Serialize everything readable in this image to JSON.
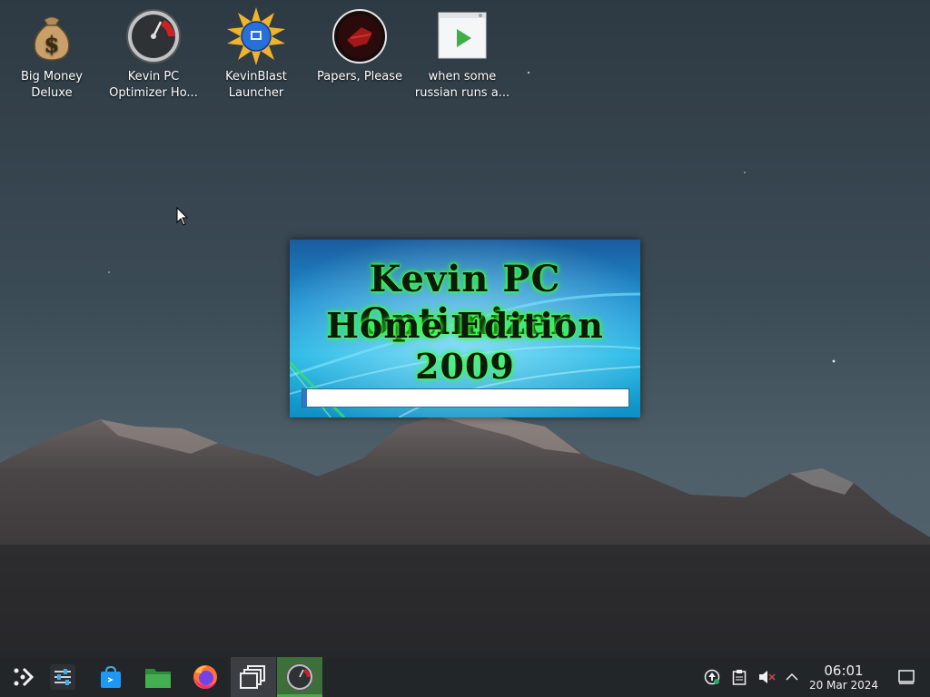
{
  "desktop": {
    "icons": [
      {
        "label": "Big Money Deluxe",
        "icon": "money-bag-icon"
      },
      {
        "label": "Kevin PC Optimizer Ho...",
        "icon": "speedometer-icon"
      },
      {
        "label": "KevinBlast Launcher",
        "icon": "globe-burst-icon"
      },
      {
        "label": "Papers, Please",
        "icon": "papers-please-icon"
      },
      {
        "label": "when some russian runs a...",
        "icon": "video-file-icon"
      }
    ]
  },
  "splash": {
    "title_line1": "Kevin PC Optimizer",
    "title_line2": "Home Edition 2009",
    "progress": 0.015
  },
  "taskbar": {
    "apps": [
      {
        "name": "application-launcher",
        "icon": "launcher-icon"
      },
      {
        "name": "system-settings",
        "icon": "settings-sliders-icon"
      },
      {
        "name": "discover",
        "icon": "store-bag-icon"
      },
      {
        "name": "file-manager",
        "icon": "folder-icon"
      },
      {
        "name": "firefox",
        "icon": "firefox-icon"
      },
      {
        "name": "window-switcher",
        "icon": "windows-icon"
      },
      {
        "name": "kevin-pc-optimizer",
        "icon": "speedometer-icon"
      }
    ],
    "tray": [
      "update-icon",
      "clipboard-icon",
      "volume-muted-icon",
      "chevron-up-icon"
    ],
    "clock": {
      "time": "06:01",
      "date": "20 Mar 2024"
    },
    "show_desktop": "show-desktop-icon"
  },
  "colors": {
    "taskbar": "#232629",
    "active_task": "#3e6f3a",
    "glow": "#3cff3c",
    "progress": "#3377cc"
  }
}
